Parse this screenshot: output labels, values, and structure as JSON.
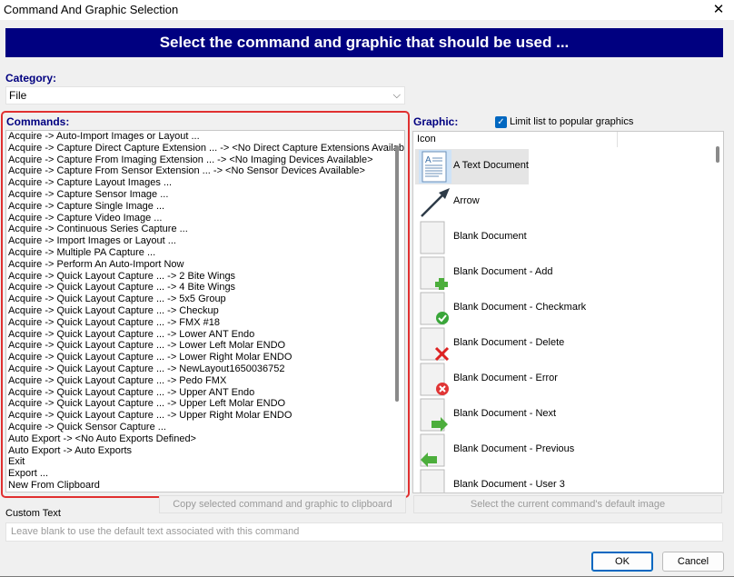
{
  "window": {
    "title": "Command And Graphic Selection",
    "close_glyph": "✕"
  },
  "banner": "Select the command and graphic that should be used ...",
  "category": {
    "label": "Category:",
    "value": "File",
    "chevron": "⌵"
  },
  "commands": {
    "label": "Commands:",
    "items": [
      "Acquire -> Auto-Import Images or Layout ...",
      "Acquire -> Capture Direct Capture Extension ... -> <No Direct Capture Extensions Available>",
      "Acquire -> Capture From Imaging Extension ... -> <No Imaging Devices Available>",
      "Acquire -> Capture From Sensor Extension ... -> <No Sensor Devices Available>",
      "Acquire -> Capture Layout Images ...",
      "Acquire -> Capture Sensor Image ...",
      "Acquire -> Capture Single Image ...",
      "Acquire -> Capture Video Image ...",
      "Acquire -> Continuous Series Capture ...",
      "Acquire -> Import Images or Layout ...",
      "Acquire -> Multiple PA Capture ...",
      "Acquire -> Perform An Auto-Import Now",
      "Acquire -> Quick Layout Capture ... -> 2 Bite Wings",
      "Acquire -> Quick Layout Capture ... -> 4 Bite Wings",
      "Acquire -> Quick Layout Capture ... -> 5x5 Group",
      "Acquire -> Quick Layout Capture ... -> Checkup",
      "Acquire -> Quick Layout Capture ... -> FMX #18",
      "Acquire -> Quick Layout Capture ... -> Lower ANT Endo",
      "Acquire -> Quick Layout Capture ... -> Lower Left Molar ENDO",
      "Acquire -> Quick Layout Capture ... -> Lower Right Molar ENDO",
      "Acquire -> Quick Layout Capture ... -> NewLayout1650036752",
      "Acquire -> Quick Layout Capture ... -> Pedo FMX",
      "Acquire -> Quick Layout Capture ... -> Upper ANT Endo",
      "Acquire -> Quick Layout Capture ... -> Upper Left Molar ENDO",
      "Acquire -> Quick Layout Capture ... -> Upper Right Molar ENDO",
      "Acquire -> Quick Sensor Capture ...",
      "Auto Export -> <No Auto Exports Defined>",
      "Auto Export -> Auto Exports",
      "Exit",
      "Export ...",
      "New From Clipboard"
    ],
    "copy_button": "Copy selected command and graphic to clipboard"
  },
  "graphic": {
    "label": "Graphic:",
    "limit_label": "Limit list to popular graphics",
    "limit_checked": true,
    "column_header": "Icon",
    "items": [
      {
        "label": "A Text Document",
        "icon": "text-document-icon"
      },
      {
        "label": "Arrow",
        "icon": "arrow-icon"
      },
      {
        "label": "Blank Document",
        "icon": "blank-document-icon"
      },
      {
        "label": "Blank Document - Add",
        "icon": "document-add-icon"
      },
      {
        "label": "Blank Document - Checkmark",
        "icon": "document-checkmark-icon"
      },
      {
        "label": "Blank Document - Delete",
        "icon": "document-delete-icon"
      },
      {
        "label": "Blank Document - Error",
        "icon": "document-error-icon"
      },
      {
        "label": "Blank Document - Next",
        "icon": "document-next-icon"
      },
      {
        "label": "Blank Document - Previous",
        "icon": "document-previous-icon"
      },
      {
        "label": "Blank Document - User 3",
        "icon": "document-user-icon"
      }
    ],
    "default_button": "Select the current command's default image"
  },
  "custom_text": {
    "label": "Custom Text",
    "placeholder": "Leave blank to use the default text associated with this command",
    "value": ""
  },
  "buttons": {
    "ok": "OK",
    "cancel": "Cancel"
  },
  "colors": {
    "banner": "#000080",
    "label_accent": "#000080",
    "highlight": "#e03030",
    "checkbox": "#0067c0"
  }
}
